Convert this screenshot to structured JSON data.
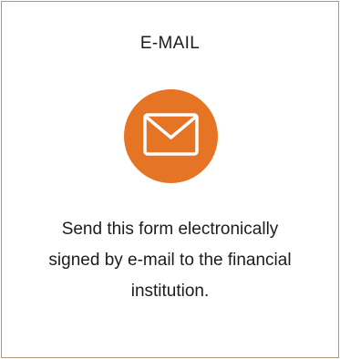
{
  "card": {
    "title": "E-MAIL",
    "icon": "envelope-icon",
    "description_lines": [
      "Send this form electronically",
      "signed by e-mail to the financial",
      "institution."
    ]
  },
  "colors": {
    "accent": "#e57425",
    "border": "#b19a6f",
    "text": "#1c1c1c"
  }
}
